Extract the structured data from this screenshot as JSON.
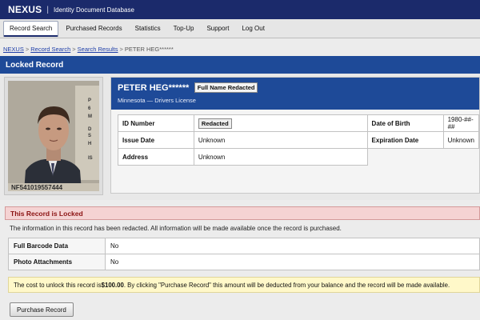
{
  "header": {
    "logo": "NEXUS",
    "separator": "|",
    "app_title": "Identity Document Database"
  },
  "nav": {
    "items": [
      {
        "label": "Record Search",
        "active": true
      },
      {
        "label": "Purchased Records"
      },
      {
        "label": "Statistics"
      },
      {
        "label": "Top-Up"
      },
      {
        "label": "Support"
      },
      {
        "label": "Log Out"
      }
    ]
  },
  "breadcrumb": {
    "items": [
      "NEXUS",
      "Record Search",
      "Search Results",
      "PETER HEG******"
    ],
    "separator": ">"
  },
  "section": {
    "title": "Locked Record"
  },
  "record": {
    "name": "PETER HEG******",
    "name_badge": "Full Name Redacted",
    "subtitle": "Minnesota — Drivers License",
    "fields": {
      "id_number_label": "ID Number",
      "id_number_value": "Redacted",
      "dob_label": "Date of Birth",
      "dob_value": "1980-##-##",
      "issue_label": "Issue Date",
      "issue_value": "Unknown",
      "exp_label": "Expiration Date",
      "exp_value": "Unknown",
      "address_label": "Address",
      "address_value": "Unknown"
    },
    "photo_id_text": "NF541019557444"
  },
  "notice": {
    "title": "This Record is Locked",
    "message": "The information in this record has been redacted. All information will be made available once the record is purchased."
  },
  "features": [
    {
      "label": "Full Barcode Data",
      "value": "No"
    },
    {
      "label": "Photo Attachments",
      "value": "No"
    }
  ],
  "cost": {
    "prefix": "The cost to unlock this record is ",
    "amount": "$100.00",
    "suffix": ". By clicking \"Purchase Record\" this amount will be deducted from your balance and the record will be made available."
  },
  "purchase_button": "Purchase Record",
  "colors": {
    "header": "#1b2a6b",
    "section_bar": "#1e4a98",
    "locked_bg": "#f5d3d3",
    "locked_text": "#8b1212",
    "cost_bg": "#fff8c9"
  }
}
